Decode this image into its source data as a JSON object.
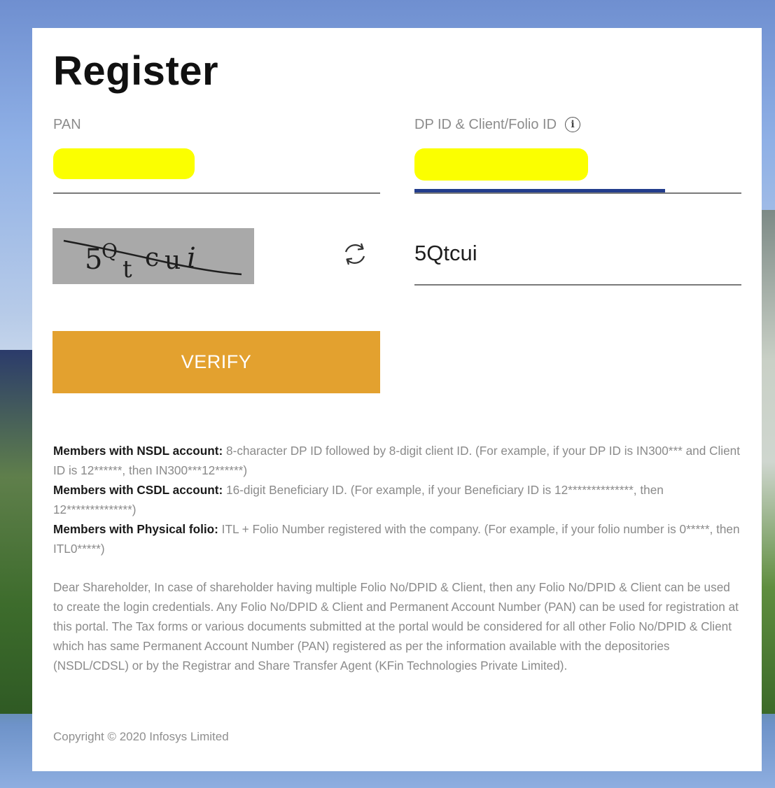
{
  "title": "Register",
  "pan": {
    "label": "PAN"
  },
  "dp_id": {
    "label": "DP ID & Client/Folio ID",
    "info_icon_glyph": "i"
  },
  "captcha": {
    "image_text": "5Qtcui",
    "refresh_icon": "refresh-icon",
    "input_value": "5Qtcui"
  },
  "verify_label": "VERIFY",
  "info": [
    {
      "heading": "Members with NSDL account:",
      "text": " 8-character DP ID followed by 8-digit client ID. (For example, if your DP ID is IN300*** and Client ID is 12******, then IN300***12******)"
    },
    {
      "heading": "Members with CSDL account:",
      "text": " 16-digit Beneficiary ID. (For example, if your Beneficiary ID is 12**************, then 12**************)"
    },
    {
      "heading": "Members with Physical folio:",
      "text": " ITL + Folio Number registered with the company. (For example, if your folio number is 0*****, then ITL0*****)"
    }
  ],
  "notice": "Dear Shareholder, In case of shareholder having multiple Folio No/DPID & Client, then any Folio No/DPID & Client can be used to create the login credentials. Any Folio No/DPID & Client and Permanent Account Number (PAN) can be used for registration at this portal. The Tax forms or various documents submitted at the portal would be considered for all other Folio No/DPID & Client which has same Permanent Account Number (PAN) registered as per the information available with the depositories (NSDL/CDSL) or by the Registrar and Share Transfer Agent (KFin Technologies Private Limited).",
  "copyright": "Copyright © 2020 Infosys Limited",
  "colors": {
    "accent": "#e3a12f",
    "focus": "#233d8c",
    "redaction": "#fbff00"
  }
}
